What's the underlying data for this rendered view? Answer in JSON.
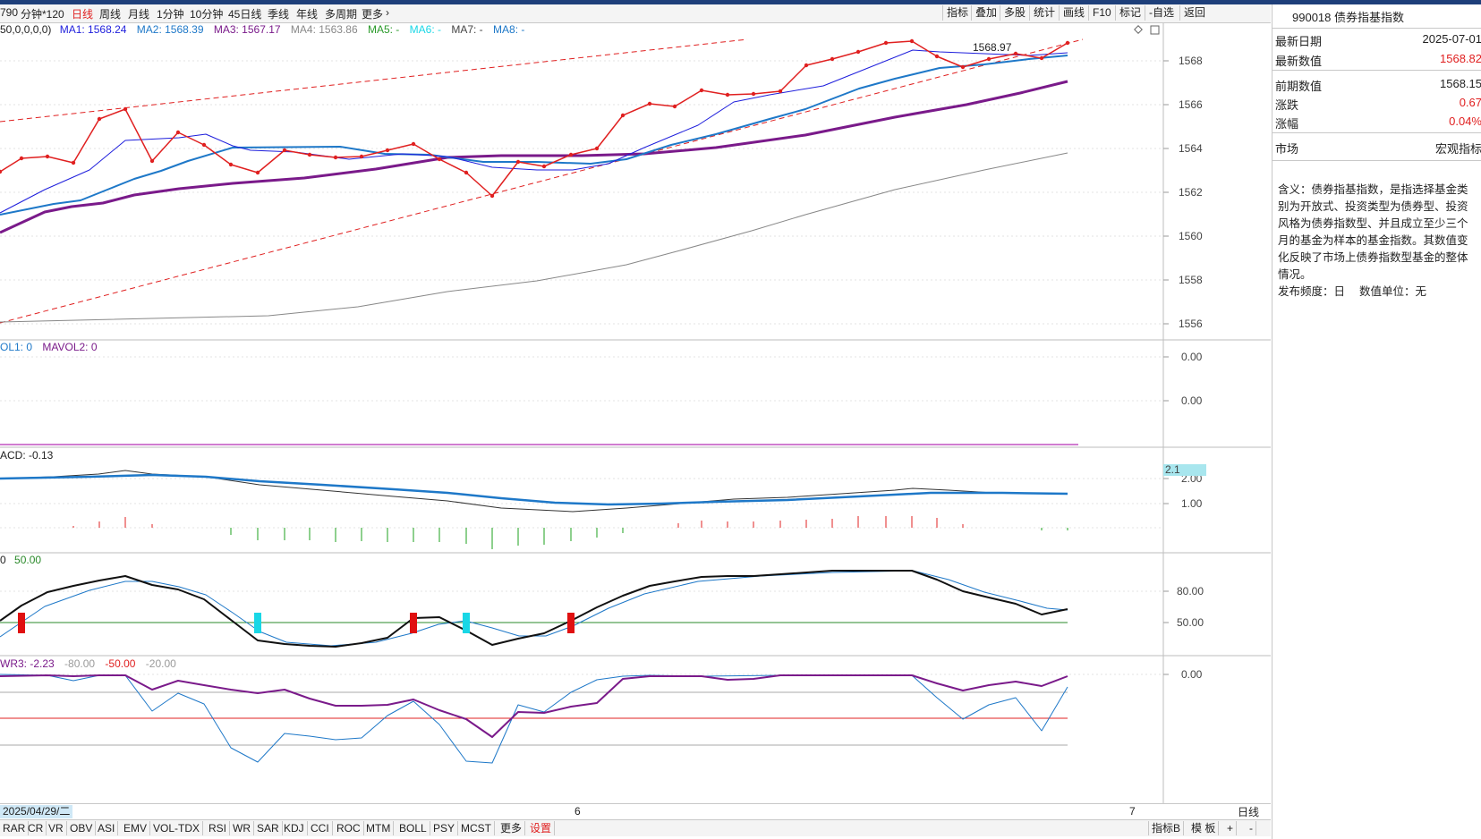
{
  "toolbar": {
    "left_fragment": "790",
    "periods": [
      "分钟*120",
      "日线",
      "周线",
      "月线",
      "1分钟",
      "10分钟",
      "45日线",
      "季线",
      "年线",
      "多周期",
      "更多"
    ],
    "active_period": "日线",
    "more_arrow": "›",
    "right_buttons": [
      "指标",
      "叠加",
      "多股",
      "统计",
      "画线",
      "F10",
      "标记",
      "-自选",
      "返回"
    ]
  },
  "main_legend": {
    "prefix": "50,0,0,0,0)",
    "items": [
      {
        "text": "MA1: 1568.24",
        "color": "#1e1edc"
      },
      {
        "text": "MA2: 1568.39",
        "color": "#1e78c8"
      },
      {
        "text": "MA3: 1567.17",
        "color": "#7a1a8a"
      },
      {
        "text": "MA4: 1563.86",
        "color": "#888888"
      },
      {
        "text": "MA5: -",
        "color": "#2a9a2a"
      },
      {
        "text": "MA6: -",
        "color": "#19d7e6"
      },
      {
        "text": "MA7: -",
        "color": "#444444"
      },
      {
        "text": "MA8: -",
        "color": "#1e78c8"
      }
    ]
  },
  "vol_legend": {
    "items": [
      {
        "text": "OL1: 0",
        "color": "#1e78c8"
      },
      {
        "text": "MAVOL2: 0",
        "color": "#7a1a8a"
      }
    ]
  },
  "macd_legend": {
    "text": "ACD: -0.13",
    "color": "#222222"
  },
  "kdj_legend": {
    "text": "50.00",
    "color": "#2a8a2a",
    "prefix": "0"
  },
  "wr_legend": {
    "items": [
      {
        "text": "WR3: -2.23",
        "color": "#7a1a8a"
      },
      {
        "text": "-80.00",
        "color": "#9a9a9a"
      },
      {
        "text": "-50.00",
        "color": "#e02020"
      },
      {
        "text": "-20.00",
        "color": "#9a9a9a"
      }
    ]
  },
  "annotation_peak": "1568.97",
  "axis": {
    "main_ticks": [
      "1568",
      "1566",
      "1564",
      "1562",
      "1560",
      "1558",
      "1556"
    ],
    "vol_ticks": [
      "0.00",
      "0.00"
    ],
    "macd_ticks": [
      "2.00",
      "1.00"
    ],
    "macd_flag": "2.1",
    "kdj_ticks": [
      "80.00",
      "50.00"
    ],
    "wr_ticks": [
      "0.00"
    ]
  },
  "date_axis": {
    "current_date": "2025/04/29/二",
    "tick_a": "6",
    "tick_b": "7",
    "period_label": "日线"
  },
  "side_panel": {
    "title": "990018 债券指基指数",
    "rows": [
      {
        "k": "最新日期",
        "v": "2025-07-01",
        "color": "#222222"
      },
      {
        "k": "最新数值",
        "v": "1568.82",
        "color": "#e02020"
      },
      {
        "k": "前期数值",
        "v": "1568.15",
        "color": "#222222"
      },
      {
        "k": "涨跌",
        "v": "0.67",
        "color": "#e02020"
      },
      {
        "k": "涨幅",
        "v": "0.04%",
        "color": "#e02020"
      },
      {
        "k": "市场",
        "v": "宏观指标",
        "color": "#222222"
      }
    ],
    "description": "含义：债券指基指数，是指选择基金类别为开放式、投资类型为债券型、投资风格为债券指数型、并且成立至少三个月的基金为样本的基金指数。其数值变化反映了市场上债券指数型基金的整体情况。",
    "freq": "发布频度：日　 数值单位：无"
  },
  "bottom_tabs": [
    "RAR",
    "CR",
    "VR",
    "OBV",
    "ASI",
    "EMV",
    "VOL-TDX",
    "RSI",
    "WR",
    "SAR",
    "KDJ",
    "CCI",
    "ROC",
    "MTM",
    "BOLL",
    "PSY",
    "MCST",
    "更多",
    "设置"
  ],
  "bottom_right": [
    "指标B",
    "模 板",
    "+",
    "-"
  ],
  "colors": {
    "up": "#e02020",
    "ma1": "#1e1edc",
    "ma2": "#1e78c8",
    "ma3": "#7a1a8a",
    "ma4": "#888888",
    "cyan": "#19d7e6",
    "green": "#2a8a2a"
  }
}
